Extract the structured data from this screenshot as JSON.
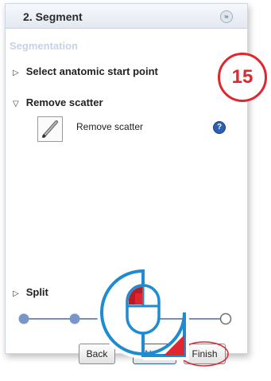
{
  "panel": {
    "title": "2. Segment",
    "collapse_glyph": "≈"
  },
  "section": {
    "label": "Segmentation"
  },
  "steps": [
    {
      "label": "Select anatomic start point",
      "expanded": false
    },
    {
      "label": "Remove scatter",
      "expanded": true
    },
    {
      "label": "Split",
      "expanded": false
    }
  ],
  "tool": {
    "label": "Remove scatter",
    "icon": "pen-icon"
  },
  "help": {
    "glyph": "?"
  },
  "annotation": {
    "badge_number": "15"
  },
  "progress": {
    "total_steps": 5,
    "completed_steps": 2
  },
  "buttons": {
    "back": "Back",
    "next": "Next",
    "finish": "Finish"
  },
  "colors": {
    "accent": "#2f5fb0",
    "progress": "#6f8fc6",
    "badge": "#e0262f",
    "mouse": "#1f8bd1",
    "section_label": "#c6d2e6"
  }
}
